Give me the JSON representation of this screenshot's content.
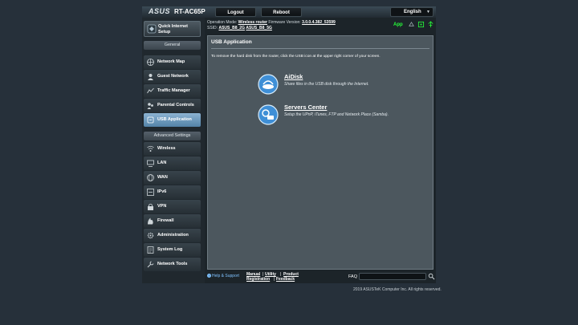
{
  "header": {
    "logo": "ASUS",
    "model": "RT-AC65P",
    "logout_label": "Logout",
    "reboot_label": "Reboot",
    "language": "English"
  },
  "info": {
    "operation_mode_label": "Operation Mode:",
    "operation_mode_value": "Wireless router",
    "firmware_label": "Firmware Version:",
    "firmware_value": "3.0.0.4.382_53599",
    "ssid_label": "SSID:",
    "ssid_2g": "ASUS_B8_2G",
    "ssid_5g": "ASUS_B8_5G",
    "app_label": "App"
  },
  "sidebar": {
    "qis_label": "Quick Internet Setup",
    "general_header": "General",
    "general_items": [
      {
        "label": "Network Map",
        "icon": "network-map-icon"
      },
      {
        "label": "Guest Network",
        "icon": "guest-network-icon"
      },
      {
        "label": "Traffic Manager",
        "icon": "traffic-manager-icon"
      },
      {
        "label": "Parental Controls",
        "icon": "parental-controls-icon"
      },
      {
        "label": "USB Application",
        "icon": "usb-application-icon",
        "active": true
      }
    ],
    "advanced_header": "Advanced Settings",
    "advanced_items": [
      {
        "label": "Wireless",
        "icon": "wireless-icon"
      },
      {
        "label": "LAN",
        "icon": "lan-icon"
      },
      {
        "label": "WAN",
        "icon": "wan-icon"
      },
      {
        "label": "IPv6",
        "icon": "ipv6-icon"
      },
      {
        "label": "VPN",
        "icon": "vpn-icon"
      },
      {
        "label": "Firewall",
        "icon": "firewall-icon"
      },
      {
        "label": "Administration",
        "icon": "administration-icon"
      },
      {
        "label": "System Log",
        "icon": "system-log-icon"
      },
      {
        "label": "Network Tools",
        "icon": "network-tools-icon"
      }
    ]
  },
  "main": {
    "title": "USB Application",
    "description": "To remove the hard disk from the router, click the USB icon at the upper right corner of your screen.",
    "features": [
      {
        "name": "AiDisk",
        "description": "Share files in the USB disk through the Internet."
      },
      {
        "name": "Servers Center",
        "description": "Setup the UPnP, iTunes, FTP and Network Place (Samba)."
      }
    ]
  },
  "footer": {
    "help_label": "Help & Support",
    "manual": "Manual",
    "utility": "Utility",
    "product_registration_line1": "Product",
    "product_registration_line2": "Registration",
    "feedback": "Feedback",
    "sep": "|",
    "faq_label": "FAQ",
    "faq_placeholder": "",
    "copyright": "2019 ASUSTeK Computer Inc. All rights reserved."
  },
  "colors": {
    "page_bg": "#26303a",
    "active_nav": "#6f98bb",
    "app_green": "#26ff3a",
    "help_blue": "#7fc2ff"
  }
}
